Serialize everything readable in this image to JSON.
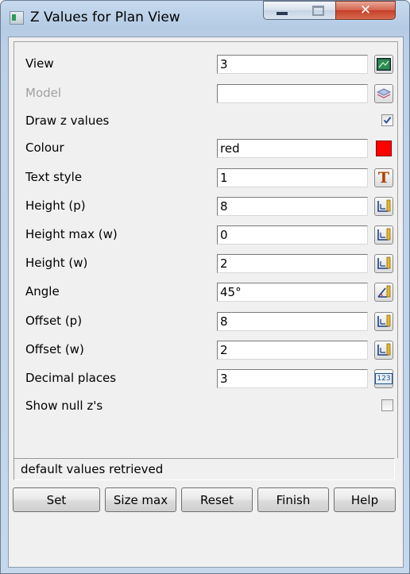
{
  "window": {
    "title": "Z Values for Plan View"
  },
  "fields": {
    "view": {
      "label": "View",
      "value": "3",
      "icon": "view-icon"
    },
    "model": {
      "label": "Model",
      "value": "",
      "icon": "layers-icon"
    },
    "draw_z": {
      "label": "Draw z values",
      "checked": true
    },
    "colour": {
      "label": "Colour",
      "value": "red",
      "swatch_color": "#ff0000"
    },
    "text_style": {
      "label": "Text style",
      "value": "1",
      "icon": "text-style-icon"
    },
    "height_p": {
      "label": "Height (p)",
      "value": "8",
      "icon": "measure-icon"
    },
    "height_max_w": {
      "label": "Height max (w)",
      "value": "0",
      "icon": "measure-icon"
    },
    "height_w": {
      "label": "Height (w)",
      "value": "2",
      "icon": "measure-icon"
    },
    "angle": {
      "label": "Angle",
      "value": "45°",
      "icon": "angle-icon"
    },
    "offset_p": {
      "label": "Offset (p)",
      "value": "8",
      "icon": "measure-icon"
    },
    "offset_w": {
      "label": "Offset (w)",
      "value": "2",
      "icon": "measure-icon"
    },
    "decimal_places": {
      "label": "Decimal places",
      "value": "3",
      "icon": "number-icon",
      "icon_text": "123"
    },
    "show_null": {
      "label": "Show null z's",
      "checked": false
    }
  },
  "status": "default values retrieved",
  "buttons": {
    "set": "Set",
    "size_max": "Size max",
    "reset": "Reset",
    "finish": "Finish",
    "help": "Help"
  }
}
